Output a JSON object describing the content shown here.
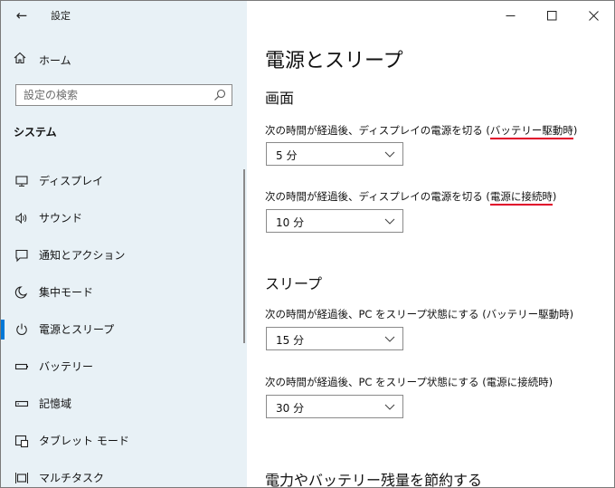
{
  "app": {
    "title": "設定"
  },
  "window_controls": {
    "minimize": "—",
    "maximize": "☐",
    "close": "✕"
  },
  "sidebar": {
    "home": {
      "label": "ホーム",
      "icon": "home-icon"
    },
    "search": {
      "placeholder": "設定の検索",
      "icon": "search-icon"
    },
    "section": "システム",
    "items": [
      {
        "label": "ディスプレイ",
        "icon": "monitor-icon",
        "active": false
      },
      {
        "label": "サウンド",
        "icon": "speaker-icon",
        "active": false
      },
      {
        "label": "通知とアクション",
        "icon": "notification-icon",
        "active": false
      },
      {
        "label": "集中モード",
        "icon": "moon-icon",
        "active": false
      },
      {
        "label": "電源とスリープ",
        "icon": "power-icon",
        "active": true
      },
      {
        "label": "バッテリー",
        "icon": "battery-icon",
        "active": false
      },
      {
        "label": "記憶域",
        "icon": "storage-icon",
        "active": false
      },
      {
        "label": "タブレット モード",
        "icon": "tablet-icon",
        "active": false
      },
      {
        "label": "マルチタスク",
        "icon": "multitask-icon",
        "active": false
      }
    ]
  },
  "main": {
    "title": "電源とスリープ",
    "screen": {
      "heading": "画面",
      "battery": {
        "label_prefix": "次の時間が経過後、ディスプレイの電源を切る (",
        "label_emph": "バッテリー駆動時",
        "label_suffix": ")",
        "value": "5 分"
      },
      "plugged": {
        "label_prefix": "次の時間が経過後、ディスプレイの電源を切る (",
        "label_emph": "電源に接続時",
        "label_suffix": ")",
        "value": "10 分"
      }
    },
    "sleep": {
      "heading": "スリープ",
      "battery": {
        "label": "次の時間が経過後、PC をスリープ状態にする (バッテリー駆動時)",
        "value": "15 分"
      },
      "plugged": {
        "label": "次の時間が経過後、PC をスリープ状態にする (電源に接続時)",
        "value": "30 分"
      }
    },
    "footer_heading": "電力やバッテリー残量を節約する"
  },
  "colors": {
    "accent": "#0078d7",
    "highlight": "#e0002a",
    "sidebar_bg": "#e8f1f6"
  }
}
